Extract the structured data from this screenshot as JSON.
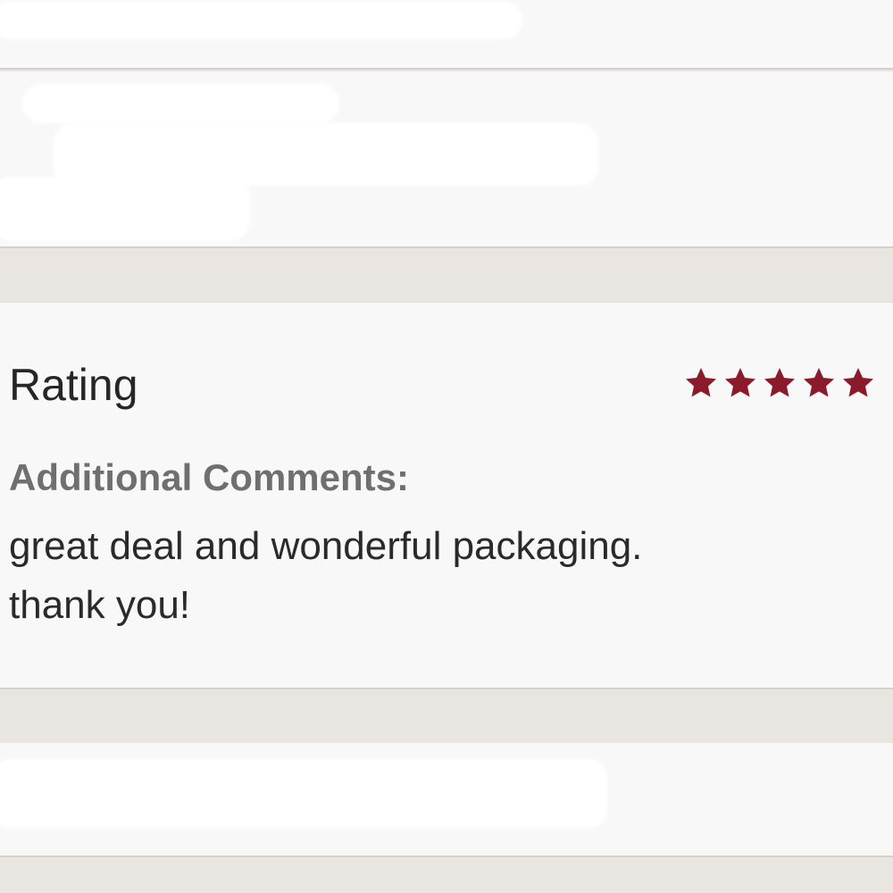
{
  "review": {
    "rating_label": "Rating",
    "rating_value": 5,
    "rating_max": 5,
    "star_color": "#8b1a2b",
    "comments_heading": "Additional Comments:",
    "comment_line_1": "great deal and wonderful packaging.",
    "comment_line_2": "thank you!"
  },
  "icons": {
    "star": "star-icon"
  },
  "colors": {
    "page_background": "#e9e6e1",
    "card_background": "#f8f8f8",
    "heading_gray": "#6f6f6f",
    "text_dark": "#2a2a2a"
  }
}
